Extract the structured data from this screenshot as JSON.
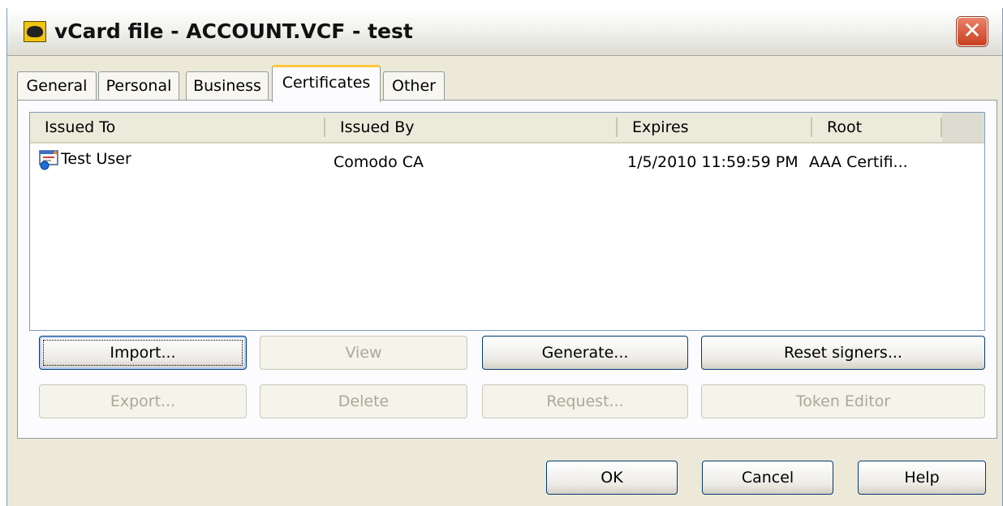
{
  "window": {
    "title": "vCard file - ACCOUNT.VCF - test",
    "close_glyph": "✕"
  },
  "tabs": [
    {
      "label": "General"
    },
    {
      "label": "Personal"
    },
    {
      "label": "Business"
    },
    {
      "label": "Certificates",
      "active": true
    },
    {
      "label": "Other"
    }
  ],
  "certificates": {
    "columns": [
      "Issued To",
      "Issued By",
      "Expires",
      "Root"
    ],
    "rows": [
      {
        "issued_to": "Test User",
        "issued_by": "Comodo CA",
        "expires": "1/5/2010 11:59:59 PM",
        "root": "AAA Certifi..."
      }
    ]
  },
  "buttons": {
    "import": "Import...",
    "view": "View",
    "generate": "Generate...",
    "reset_signers": "Reset signers...",
    "export": "Export...",
    "delete": "Delete",
    "request": "Request...",
    "token_editor": "Token Editor",
    "ok": "OK",
    "cancel": "Cancel",
    "help": "Help"
  },
  "colors": {
    "dialog_bg": "#ece9d8",
    "tab_active_accent": "#ffc83c",
    "button_border": "#003c74",
    "close_button": "#c9401f"
  },
  "icons": {
    "app": "bat-icon",
    "certificate": "certificate-icon",
    "close": "close-icon"
  }
}
